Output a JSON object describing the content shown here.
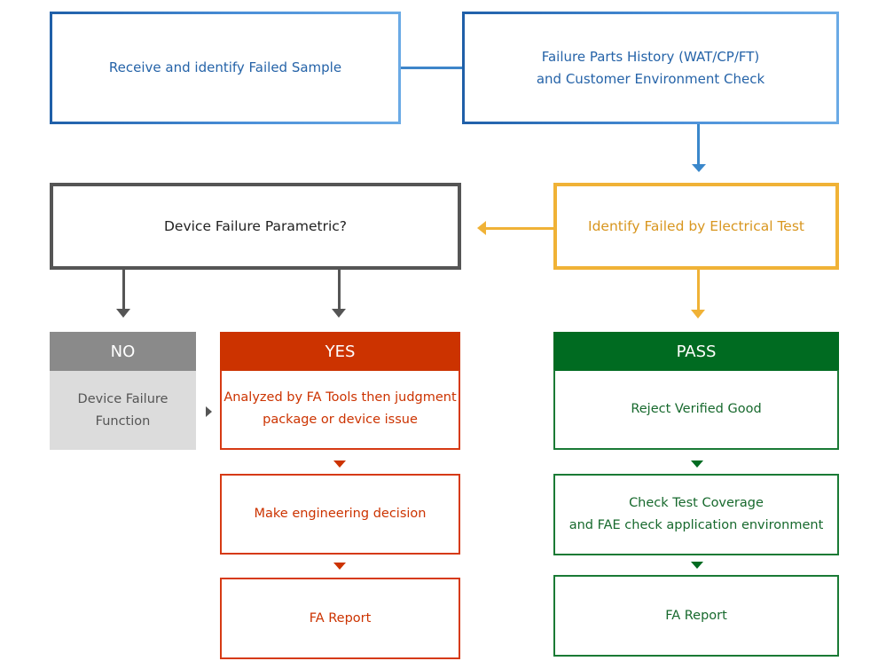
{
  "diagram": {
    "colors": {
      "blue": "#2563a8",
      "blue_border_start": "#1f5fa8",
      "blue_border_end": "#6aaae5",
      "gray_dark": "#555555",
      "orange": "#f0b236",
      "orange_text": "#d8961f",
      "no_header": "#8a8a8a",
      "no_body": "#dcdcdc",
      "red": "#cc3300",
      "green": "#006b21"
    },
    "top_row": {
      "receive": {
        "lines": [
          "Receive and identify Failed Sample"
        ]
      },
      "history": {
        "lines": [
          "Failure Parts History (WAT/CP/FT)",
          "and Customer Environment Check"
        ]
      }
    },
    "decision": {
      "parametric": {
        "lines": [
          "Device Failure Parametric?"
        ]
      },
      "electrical": {
        "lines": [
          "Identify Failed by Electrical Test"
        ]
      }
    },
    "no_branch": {
      "header": "NO",
      "body": [
        "Device Failure",
        "Function"
      ]
    },
    "yes_branch": {
      "header": "YES",
      "steps": [
        {
          "lines": [
            "Analyzed by FA Tools then judgment",
            "package or device issue"
          ]
        },
        {
          "lines": [
            "Make engineering decision"
          ]
        },
        {
          "lines": [
            "FA Report"
          ]
        }
      ]
    },
    "pass_branch": {
      "header": "PASS",
      "steps": [
        {
          "lines": [
            "Reject Verified Good"
          ]
        },
        {
          "lines": [
            "Check Test Coverage",
            "and FAE check application environment"
          ]
        },
        {
          "lines": [
            "FA Report"
          ]
        }
      ]
    },
    "connections": [
      {
        "from": "receive",
        "to": "history",
        "type": "line"
      },
      {
        "from": "history",
        "to": "electrical",
        "type": "arrow-down"
      },
      {
        "from": "electrical",
        "to": "parametric",
        "type": "arrow-left"
      },
      {
        "from": "electrical",
        "to": "pass_branch",
        "type": "arrow-down"
      },
      {
        "from": "parametric",
        "to": "no_branch",
        "type": "arrow-down"
      },
      {
        "from": "parametric",
        "to": "yes_branch",
        "type": "arrow-down"
      },
      {
        "from": "no_branch",
        "to": "yes_branch",
        "type": "arrow-right"
      }
    ]
  }
}
